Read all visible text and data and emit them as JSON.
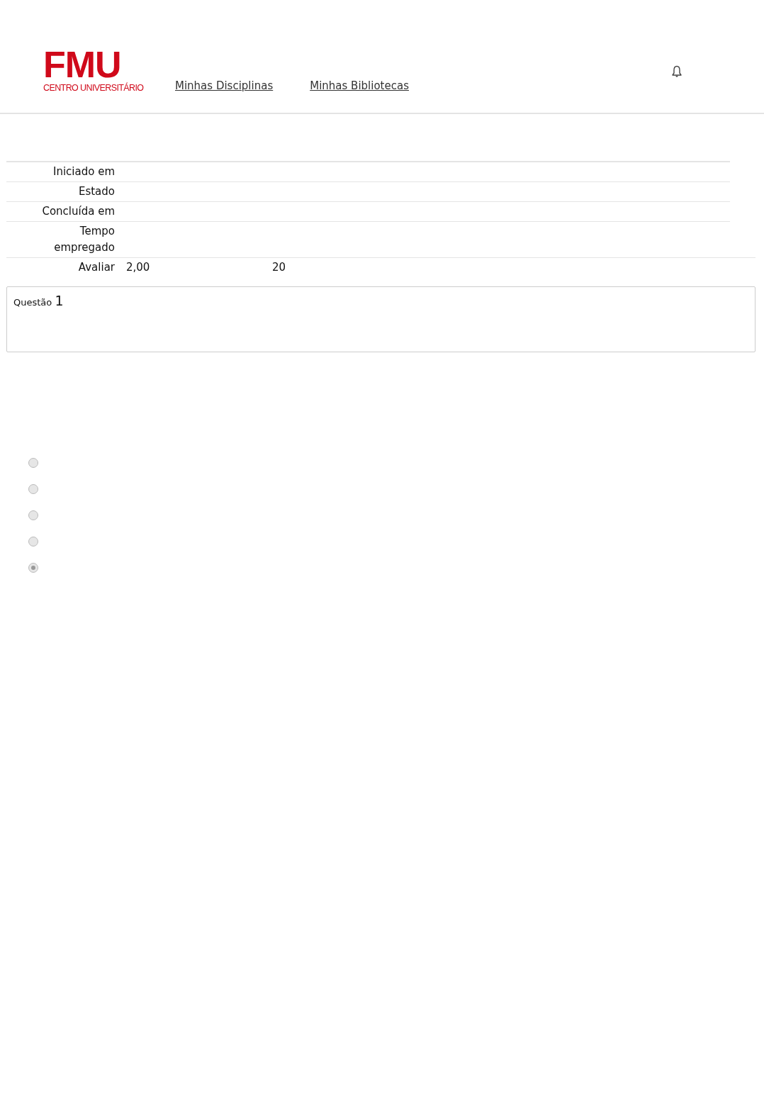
{
  "header": {
    "logo": {
      "title": "FMU",
      "subtitle": "CENTRO UNIVERSITÁRIO"
    },
    "nav": [
      "Minhas Disciplinas",
      "Minhas Bibliotecas"
    ]
  },
  "summary": [
    {
      "label": "Iniciado em"
    },
    {
      "label": "Estado"
    },
    {
      "label": "Concluída em"
    },
    {
      "label": "Tempo empregado"
    },
    {
      "label": "Avaliar",
      "values": [
        "2,00",
        "20"
      ]
    }
  ],
  "question": {
    "label": "Questão",
    "number": "1"
  },
  "options": [
    {
      "selected": false,
      "disabled": true
    },
    {
      "selected": false,
      "disabled": true
    },
    {
      "selected": false,
      "disabled": true
    },
    {
      "selected": false,
      "disabled": true
    },
    {
      "selected": true,
      "disabled": true
    }
  ]
}
